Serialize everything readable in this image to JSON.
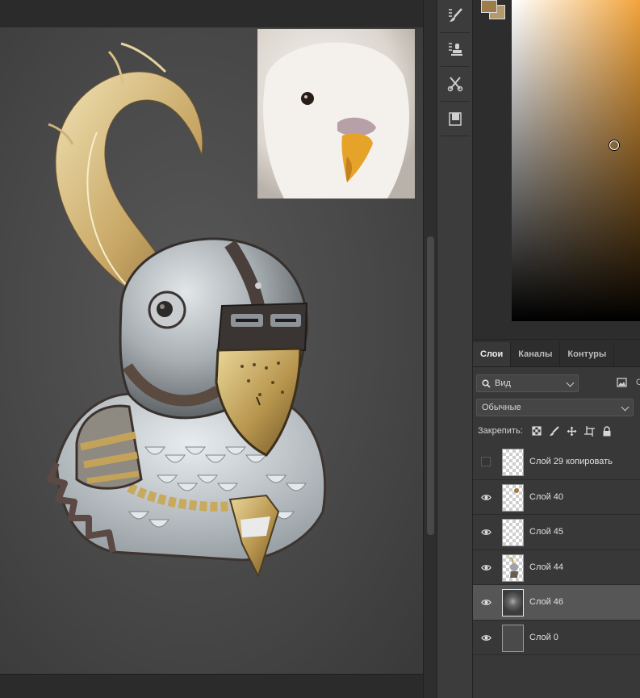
{
  "layers_panel": {
    "tabs": [
      "Слои",
      "Каналы",
      "Контуры"
    ],
    "active_tab": 0,
    "filter": {
      "label": "Вид",
      "extra": "О"
    },
    "blend_mode": "Обычные",
    "lock_label": "Закрепить:",
    "layers": [
      {
        "name": "Слой 29 копировать",
        "visible": false,
        "thumb": "transparent"
      },
      {
        "name": "Слой 40",
        "visible": true,
        "thumb": "transparent"
      },
      {
        "name": "Слой 45",
        "visible": true,
        "thumb": "transparent"
      },
      {
        "name": "Слой 44",
        "visible": true,
        "thumb": "art"
      },
      {
        "name": "Слой 46",
        "visible": true,
        "thumb": "darkart",
        "selected": true
      },
      {
        "name": "Слой 0",
        "visible": true,
        "thumb": "dark"
      }
    ]
  },
  "tools": [
    "brush-settings-icon",
    "clone-source-icon",
    "tool-presets-icon",
    "notes-icon"
  ],
  "colors": {
    "foreground": "#9c7d4a",
    "background": "#b49a6a",
    "picker_hue": "#f2a43b",
    "canvas_bg": "#454545",
    "panel_bg": "#383838",
    "selected_row": "#565656"
  }
}
